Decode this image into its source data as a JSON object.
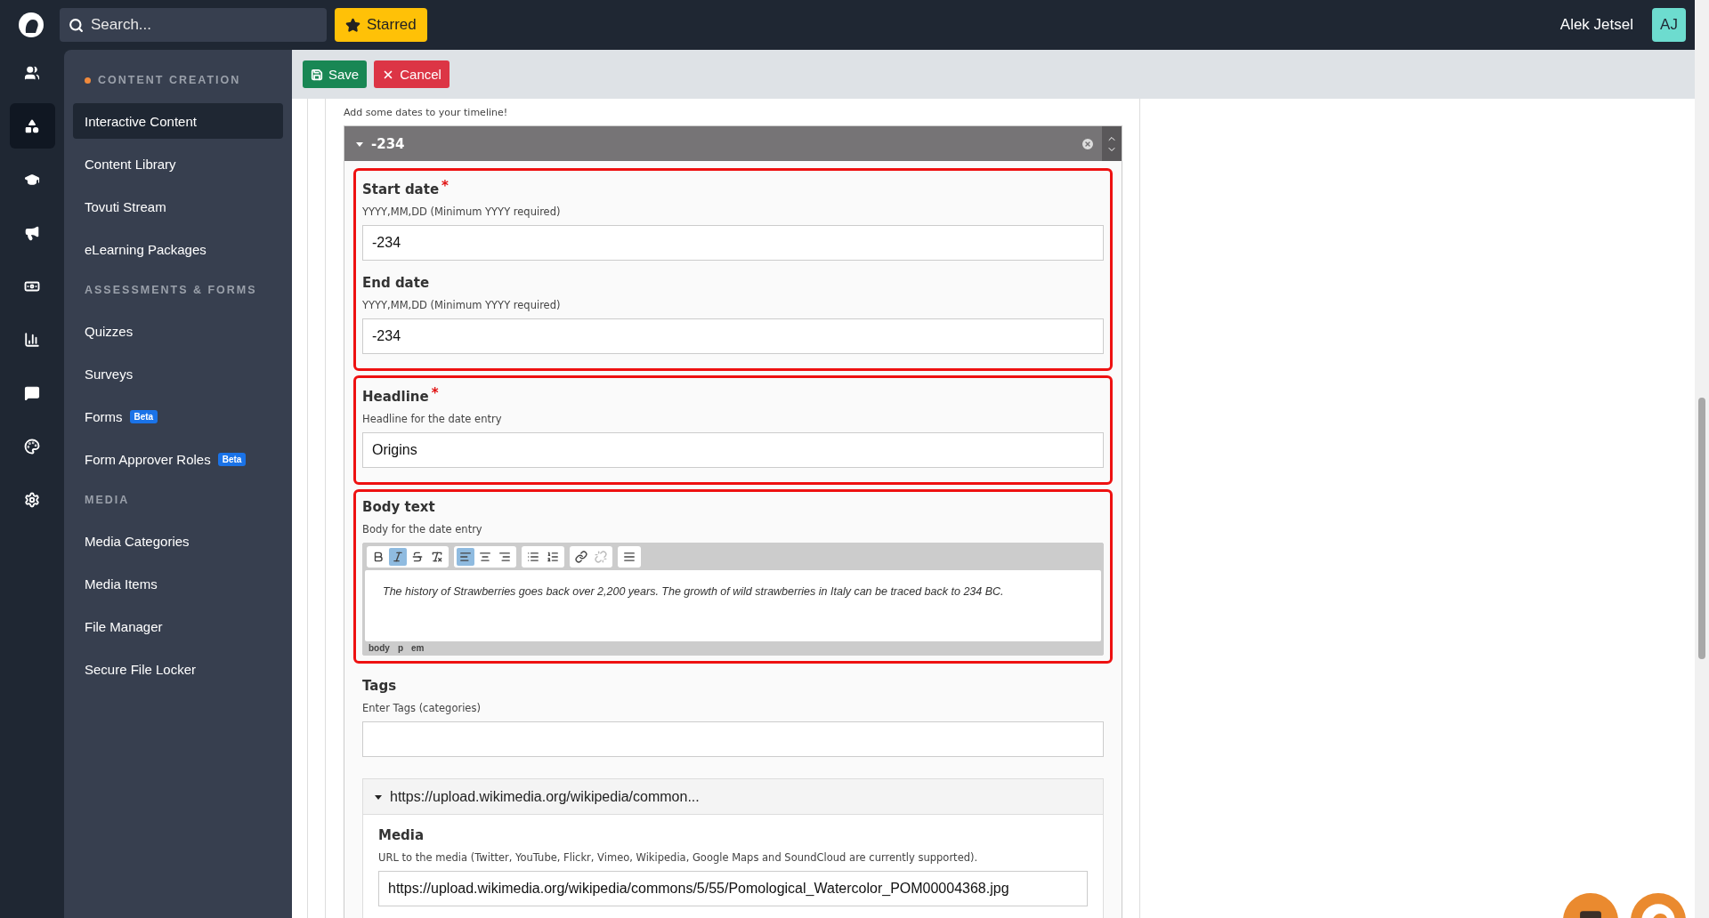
{
  "top_bar": {
    "search": {
      "placeholder": "Search..."
    },
    "starred_button": "Starred",
    "user": {
      "name": "Alek Jetsel",
      "initials": "AJ"
    }
  },
  "rail": [
    {
      "kind": "users",
      "selected": false
    },
    {
      "kind": "shapes",
      "selected": true
    },
    {
      "kind": "cap",
      "selected": false
    },
    {
      "kind": "megaphone",
      "selected": false
    },
    {
      "kind": "money",
      "selected": false
    },
    {
      "kind": "chart",
      "selected": false
    },
    {
      "kind": "message",
      "selected": false
    },
    {
      "kind": "palette",
      "selected": false
    },
    {
      "kind": "settings",
      "selected": false
    }
  ],
  "sidebar": {
    "sections": [
      {
        "title": "CONTENT CREATION",
        "current": true,
        "items": [
          {
            "label": "Interactive Content",
            "selected": true
          },
          {
            "label": "Content Library",
            "selected": false
          },
          {
            "label": "Tovuti Stream",
            "selected": false
          },
          {
            "label": "eLearning Packages",
            "selected": false
          }
        ]
      },
      {
        "title": "ASSESSMENTS & FORMS",
        "current": false,
        "items": [
          {
            "label": "Quizzes",
            "selected": false
          },
          {
            "label": "Surveys",
            "selected": false
          },
          {
            "label": "Forms",
            "selected": false,
            "badge": "Beta"
          },
          {
            "label": "Form Approver Roles",
            "selected": false,
            "badge": "Beta"
          }
        ]
      },
      {
        "title": "MEDIA",
        "current": false,
        "items": [
          {
            "label": "Media Categories",
            "selected": false
          },
          {
            "label": "Media Items",
            "selected": false
          },
          {
            "label": "File Manager",
            "selected": false
          },
          {
            "label": "Secure File Locker",
            "selected": false
          }
        ]
      }
    ]
  },
  "actions": [
    {
      "kind": "save",
      "label": "Save"
    },
    {
      "kind": "cancel",
      "label": "Cancel"
    }
  ],
  "form": {
    "intro": "Add some dates to your timeline!",
    "entry": {
      "title": "-234",
      "expanded": true,
      "groups": [
        {
          "highlighted": true,
          "fields": [
            {
              "kind": "text",
              "label": "Start date",
              "marker": "*",
              "hint": "YYYY,MM,DD (Minimum YYYY required)",
              "value": "-234"
            },
            {
              "kind": "text",
              "label": "End date",
              "hint": "YYYY,MM,DD (Minimum YYYY required)",
              "value": "-234"
            }
          ]
        },
        {
          "highlighted": true,
          "fields": [
            {
              "kind": "text",
              "label": "Headline",
              "marker": "*",
              "hint": "Headline for the date entry",
              "value": "Origins"
            }
          ]
        },
        {
          "highlighted": true,
          "fields": [
            {
              "kind": "editor",
              "label": "Body text",
              "hint": "Body for the date entry",
              "toolbar": [
                [
                  {
                    "kind": "bold",
                    "selected": false
                  },
                  {
                    "kind": "italic",
                    "selected": true
                  },
                  {
                    "kind": "strike",
                    "selected": false
                  },
                  {
                    "kind": "clear",
                    "selected": false
                  }
                ],
                [
                  {
                    "kind": "align-left",
                    "selected": true
                  },
                  {
                    "kind": "align-center",
                    "selected": false
                  },
                  {
                    "kind": "align-right",
                    "selected": false
                  }
                ],
                [
                  {
                    "kind": "bullets",
                    "selected": false
                  },
                  {
                    "kind": "numbers",
                    "selected": false
                  }
                ],
                [
                  {
                    "kind": "link",
                    "selected": false
                  },
                  {
                    "kind": "unlink",
                    "selected": false,
                    "disabled": true
                  }
                ],
                [
                  {
                    "kind": "rule",
                    "selected": false
                  }
                ]
              ],
              "value": "The history of Strawberries goes back over 2,200 years. The growth of wild strawberries in Italy can be traced back to 234 BC.",
              "path": [
                "body",
                "p",
                "em"
              ]
            }
          ]
        },
        {
          "highlighted": false,
          "fields": [
            {
              "kind": "text",
              "label": "Tags",
              "hint": "Enter Tags (categories)"
            }
          ]
        }
      ],
      "media": {
        "title": "https://upload.wikimedia.org/wikipedia/common...",
        "expanded": true,
        "fields": [
          {
            "kind": "text",
            "label": "Media",
            "hint": "URL to the media (Twitter, YouTube, Flickr, Vimeo, Wikipedia, Google Maps and SoundCloud are currently supported).",
            "value": "https://upload.wikimedia.org/wikipedia/commons/5/55/Pomological_Watercolor_POM00004368.jpg"
          }
        ]
      }
    }
  }
}
